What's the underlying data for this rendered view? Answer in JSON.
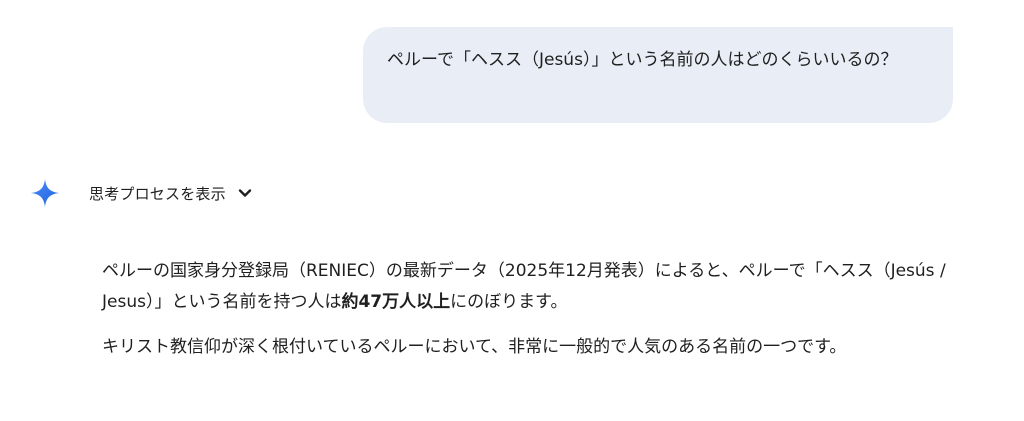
{
  "user_message": {
    "text": "ペルーで「ヘスス（Jesús）」という名前の人はどのくらいいるの？"
  },
  "thinking": {
    "label": "思考プロセスを表示",
    "icon": "sparkle-icon",
    "chevron_icon": "chevron-down-icon",
    "accent_color": "#4285f4"
  },
  "answer": {
    "paragraph_1": {
      "before": "ペルーの国家身分登録局（RENIEC）の最新データ（2025年12月発表）によると、ペルーで「ヘスス（Jesús / Jesus）」という名前を持つ人は",
      "bold": "約47万人以上",
      "after": "にのぼります。"
    },
    "paragraph_2": "キリスト教信仰が深く根付いているペルーにおいて、非常に一般的で人気のある名前の一つです。"
  },
  "colors": {
    "user_bubble_bg": "#e9eef6",
    "text": "#1f1f1f"
  }
}
